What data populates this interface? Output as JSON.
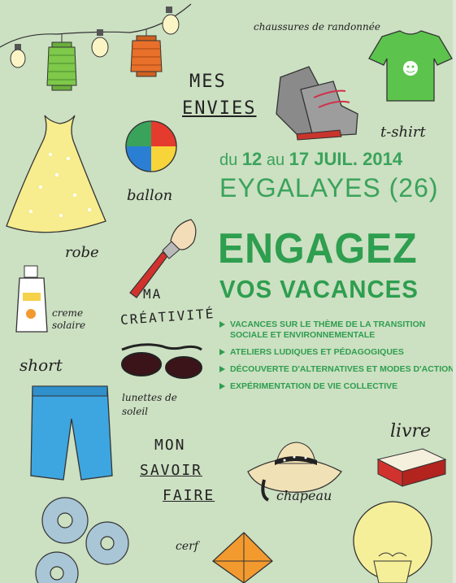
{
  "labels": {
    "chaussures": "chaussures de randonnée",
    "mes_envies_1": "MES",
    "mes_envies_2": "ENVIES",
    "tshirt": "t-shirt",
    "ballon": "ballon",
    "robe": "robe",
    "ma": "MA",
    "creativite": "CRÉATIVITÉ",
    "creme": "creme solaire",
    "short": "short",
    "lunettes": "lunettes de soleil",
    "mon": "MON",
    "savoir": "SAVOIR",
    "faire": "FAIRE",
    "livre": "livre",
    "chapeau": "chapeau",
    "cerf": "cerf"
  },
  "headline": {
    "date_prefix": "du",
    "date_start": "12",
    "date_mid": "au",
    "date_end": "17 JUIL. 2014",
    "location": "EYGALAYES (26)",
    "title_line1": "ENGAGEZ",
    "title_line2": "VOS VACANCES"
  },
  "bullets": [
    "Vacances sur le thème de la transition sociale et environnementale",
    "Ateliers ludiques et pédagogiques",
    "Découverte d'alternatives et modes d'action",
    "Expérimentation de vie collective"
  ],
  "colors": {
    "background": "#cce0c2",
    "title_green": "#2e9e4f",
    "lantern_green": "#7ec84a",
    "lantern_orange": "#e8702a",
    "dress_yellow": "#f7ec8e",
    "shorts_blue": "#3da6e0",
    "tshirt_green": "#5cc44d"
  },
  "icons": [
    "lantern-icon",
    "bulb-icon",
    "dress-icon",
    "beach-ball-icon",
    "hiking-boots-icon",
    "tshirt-icon",
    "paintbrush-icon",
    "sunscreen-icon",
    "sunglasses-icon",
    "shorts-icon",
    "hat-icon",
    "book-icon",
    "gears-icon",
    "lightbulb-icon",
    "kite-icon"
  ]
}
